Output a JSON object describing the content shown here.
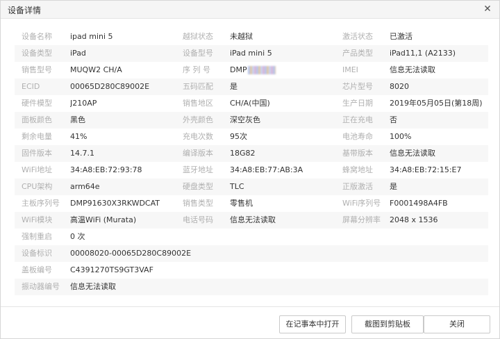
{
  "dialog": {
    "title": "设备详情",
    "close_glyph": "×"
  },
  "rows": [
    [
      {
        "k": "设备名称",
        "v": "ipad mini 5"
      },
      {
        "k": "越狱状态",
        "v": "未越狱"
      },
      {
        "k": "激活状态",
        "v": "已激活"
      }
    ],
    [
      {
        "k": "设备类型",
        "v": "iPad"
      },
      {
        "k": "设备型号",
        "v": "iPad mini 5"
      },
      {
        "k": "产品类型",
        "v": "iPad11,1 (A2133)"
      }
    ],
    [
      {
        "k": "销售型号",
        "v": "MUQW2 CH/A"
      },
      {
        "k": "序 列 号",
        "v": "DMP"
      },
      {
        "k": "IMEI",
        "v": "信息无法读取"
      }
    ],
    [
      {
        "k": "ECID",
        "v": "00065D280C89002E"
      },
      {
        "k": "五码匹配",
        "v": "是"
      },
      {
        "k": "芯片型号",
        "v": "8020"
      }
    ],
    [
      {
        "k": "硬件模型",
        "v": "J210AP"
      },
      {
        "k": "销售地区",
        "v": "CH/A(中国)"
      },
      {
        "k": "生产日期",
        "v": "2019年05月05日(第18周)"
      }
    ],
    [
      {
        "k": "面板颜色",
        "v": "黑色"
      },
      {
        "k": "外壳颜色",
        "v": "深空灰色"
      },
      {
        "k": "正在充电",
        "v": "否"
      }
    ],
    [
      {
        "k": "剩余电量",
        "v": "41%"
      },
      {
        "k": "充电次数",
        "v": "95次"
      },
      {
        "k": "电池寿命",
        "v": "100%"
      }
    ],
    [
      {
        "k": "固件版本",
        "v": "14.7.1"
      },
      {
        "k": "编译版本",
        "v": "18G82"
      },
      {
        "k": "基带版本",
        "v": "信息无法读取"
      }
    ],
    [
      {
        "k": "WiFi地址",
        "v": "34:A8:EB:72:93:78"
      },
      {
        "k": "蓝牙地址",
        "v": "34:A8:EB:77:AB:3A"
      },
      {
        "k": "蜂窝地址",
        "v": "34:A8:EB:72:15:E7"
      }
    ],
    [
      {
        "k": "CPU架构",
        "v": "arm64e"
      },
      {
        "k": "硬盘类型",
        "v": "TLC"
      },
      {
        "k": "正版激活",
        "v": "是"
      }
    ],
    [
      {
        "k": "主板序列号",
        "v": "DMP91630X3RKWDCAT"
      },
      {
        "k": "销售类型",
        "v": "零售机"
      },
      {
        "k": "WiFi序列号",
        "v": "F0001498A4FB"
      }
    ],
    [
      {
        "k": "WiFi模块",
        "v": "高温WiFi (Murata)"
      },
      {
        "k": "电话号码",
        "v": "信息无法读取"
      },
      {
        "k": "屏幕分辨率",
        "v": "2048 x 1536"
      }
    ],
    [
      {
        "k": "强制重启",
        "v": "0 次"
      }
    ],
    [
      {
        "k": "设备标识",
        "v": "00008020-00065D280C89002E"
      }
    ],
    [
      {
        "k": "盖板编号",
        "v": "C4391270TS9GT3VAF"
      }
    ],
    [
      {
        "k": "振动器编号",
        "v": "信息无法读取"
      }
    ]
  ],
  "footer": {
    "open_notepad_label": "在记事本中打开",
    "copy_screenshot_label": "截图到剪贴板",
    "close_label": "关闭"
  },
  "colors": {
    "key_text": "#b0b0b0",
    "value_text": "#333333",
    "row_alt": "#f7f7f7",
    "title_bar": "#f5f5f5"
  }
}
